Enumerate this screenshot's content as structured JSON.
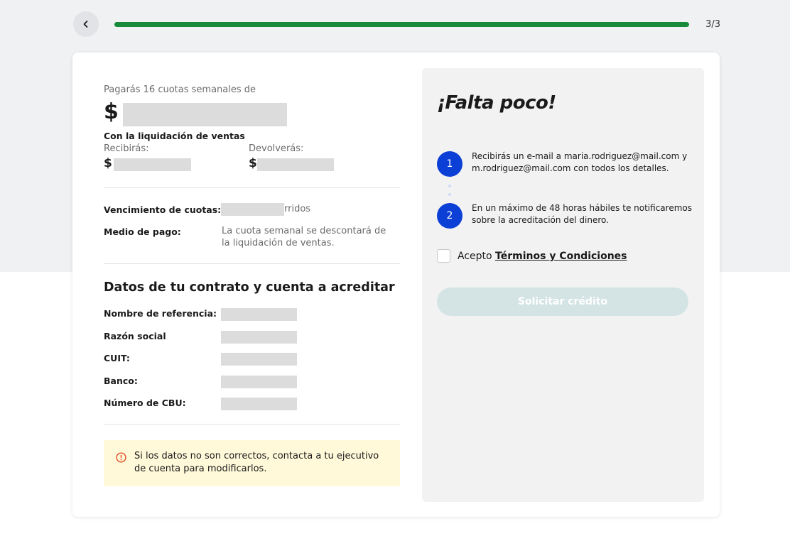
{
  "header": {
    "progress_fraction": 1,
    "step_count": "3/3",
    "progress_color": "#188a3b"
  },
  "summary": {
    "installments_text": "Pagarás 16 cuotas semanales de",
    "currency": "$",
    "settlement_title": "Con la liquidación de ventas",
    "receive_label": "Recibirás:",
    "return_label": "Devolverás:"
  },
  "details": {
    "due_label": "Vencimiento de cuotas:",
    "due_value_suffix": "rridos",
    "payment_label": "Medio de pago:",
    "payment_value": "La cuota semanal se descontará de la liquidación de ventas."
  },
  "contract": {
    "title": "Datos de tu contrato y cuenta a acreditar",
    "fields": [
      {
        "label": "Nombre de referencia:"
      },
      {
        "label": "Razón social"
      },
      {
        "label": "CUIT:"
      },
      {
        "label": "Banco:"
      },
      {
        "label": "Número de CBU:"
      }
    ]
  },
  "alert": {
    "icon": "info-icon",
    "text": "Si los datos no son correctos, contacta a tu ejecutivo de cuenta para modificarlos.",
    "background": "#fff8d9"
  },
  "panel": {
    "title": "¡Falta poco!",
    "steps": [
      {
        "number": "1",
        "text": "Recibirás un e-mail a maria.rodriguez@mail.com y m.rodriguez@mail.com con todos los detalles."
      },
      {
        "number": "2",
        "text": "En un máximo de 48 horas hábiles te notificaremos sobre la acreditación del dinero."
      }
    ],
    "terms_prefix": "Acepto",
    "terms_link": "Términos y Condiciones",
    "submit_label": "Solicitar crédito",
    "step_color": "#0b3fd6"
  }
}
